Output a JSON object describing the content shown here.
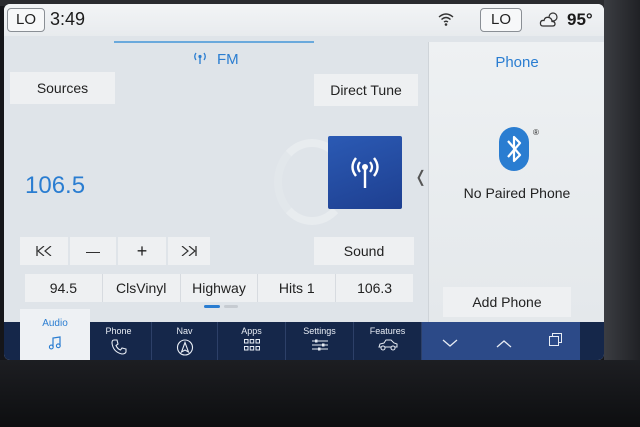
{
  "status_bar": {
    "left_climate": "LO",
    "time": "3:49",
    "right_climate": "LO",
    "temperature": "95°"
  },
  "audio": {
    "band": "FM",
    "sources_label": "Sources",
    "direct_tune_label": "Direct Tune",
    "frequency": "106.5",
    "sound_label": "Sound",
    "seek_back_symbol": "⏮",
    "minus_symbol": "—",
    "plus_symbol": "+",
    "seek_forward_symbol": "⏭",
    "presets": [
      "94.5",
      "ClsVinyl",
      "Highway",
      "Hits 1",
      "106.3"
    ]
  },
  "phone": {
    "title": "Phone",
    "status": "No Paired Phone",
    "add_phone_label": "Add Phone"
  },
  "nav": {
    "items": [
      {
        "label": "Audio",
        "icon": "music-note-icon"
      },
      {
        "label": "Phone",
        "icon": "phone-icon"
      },
      {
        "label": "Nav",
        "icon": "navigation-arrow-icon"
      },
      {
        "label": "Apps",
        "icon": "apps-grid-icon"
      },
      {
        "label": "Settings",
        "icon": "sliders-icon"
      },
      {
        "label": "Features",
        "icon": "car-icon"
      }
    ]
  },
  "colors": {
    "accent": "#2a7dd1",
    "nav_bg": "#15274a",
    "nav_active_right": "#2c4a88"
  }
}
